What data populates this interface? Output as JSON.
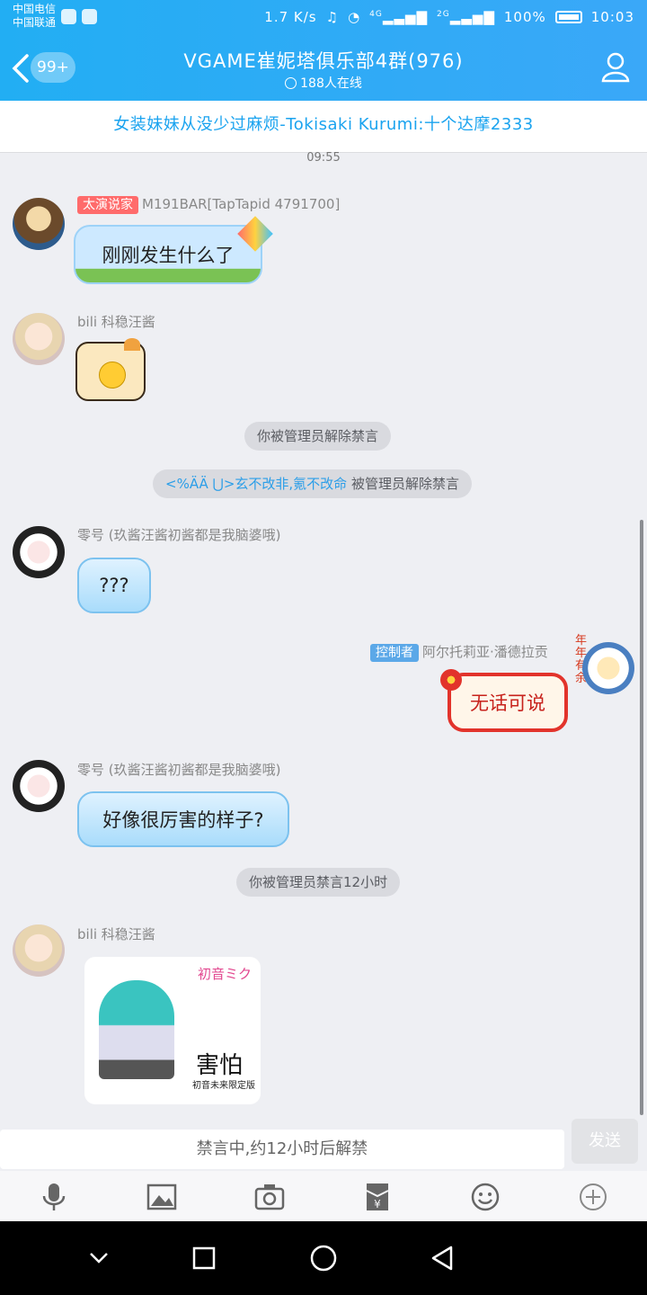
{
  "status_bar": {
    "carrier_1": "中国电信",
    "carrier_2": "中国联通",
    "speed": "1.7 K/s",
    "network_1": "4G",
    "network_2": "2G",
    "battery": "100%",
    "time": "10:03"
  },
  "header": {
    "unread_badge": "99+",
    "title": "VGAME崔妮塔俱乐部4群(976)",
    "online_count": "188人在线"
  },
  "pinned_notice": "女装妹妹从没少过麻烦-Tokisaki Kurumi:十个达摩2333",
  "time_divider": "09:55",
  "messages": [
    {
      "sender": "M191BAR[TapTapid 4791700]",
      "role": "太演说家",
      "role_color": "#ff6b6b",
      "text": "刚刚发生什么了"
    },
    {
      "sender": "bili 科稳汪酱",
      "sticker": "cat-emoji-sticker"
    },
    {
      "system": "你被管理员解除禁言"
    },
    {
      "system_user": "<%ÄÄ ⋃>玄不改非,氪不改命",
      "system": "被管理员解除禁言"
    },
    {
      "sender": "零号 (玖酱汪酱初酱都是我脑婆哦)",
      "text": "???"
    },
    {
      "sender": "阿尔托莉亚·潘德拉贡",
      "role": "控制者",
      "role_color": "#5ba8e8",
      "text": "无话可说",
      "avatar_tag": "年年有余"
    },
    {
      "sender": "零号 (玖酱汪酱初酱都是我脑婆哦)",
      "text": "好像很厉害的样子?"
    },
    {
      "system": "你被管理员禁言12小时"
    },
    {
      "sender": "bili 科稳汪酱",
      "sticker_logo": "初音ミク",
      "sticker_text": "害怕",
      "sticker_sub": "初音未来限定版"
    }
  ],
  "input": {
    "placeholder": "禁言中,约12小时后解禁",
    "send_label": "发送"
  },
  "colors": {
    "header": "#22aef3",
    "accent": "#1aa3ef"
  },
  "toolbar_icons": [
    "microphone-icon",
    "image-icon",
    "camera-icon",
    "red-packet-icon",
    "emoji-icon",
    "plus-icon"
  ],
  "nav_icons": [
    "chevron-down-icon",
    "square-icon",
    "circle-icon",
    "triangle-back-icon"
  ]
}
